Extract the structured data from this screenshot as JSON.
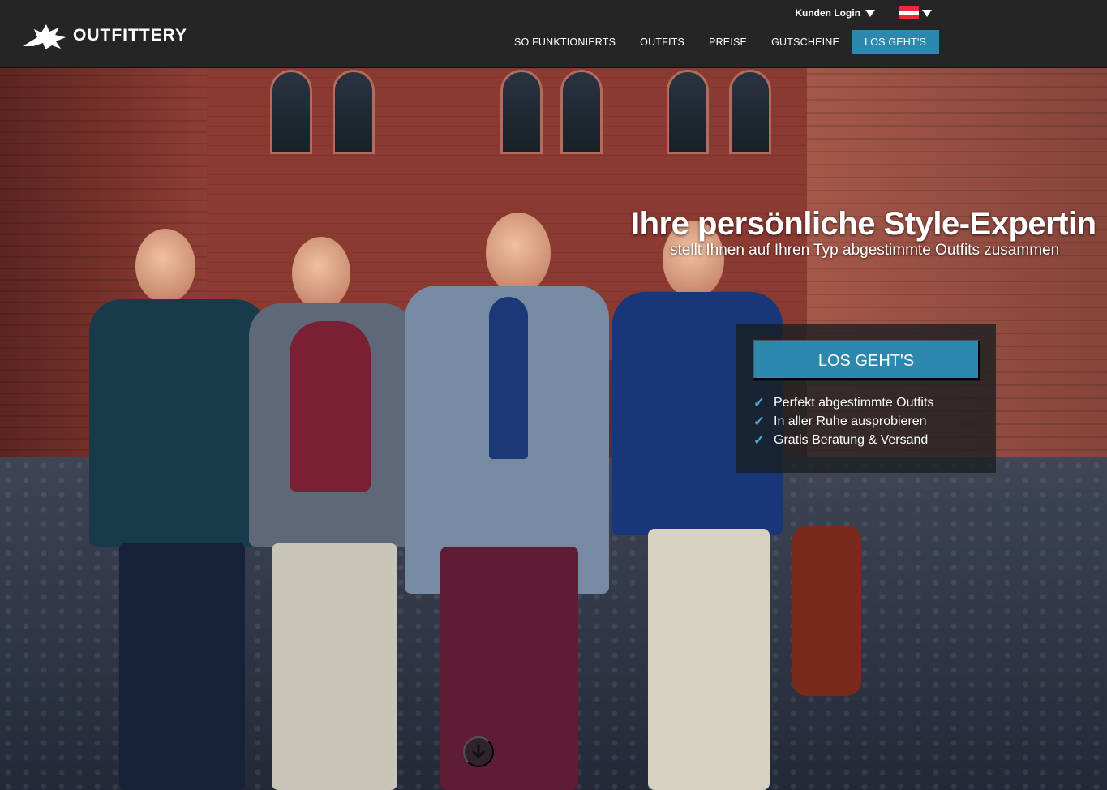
{
  "header": {
    "brand": "OUTFITTERY",
    "login_label": "Kunden Login",
    "language": "AT",
    "nav": [
      {
        "label": "SO FUNKTIONIERTS"
      },
      {
        "label": "OUTFITS"
      },
      {
        "label": "PREISE"
      },
      {
        "label": "GUTSCHEINE"
      },
      {
        "label": "LOS GEHT'S"
      }
    ]
  },
  "hero": {
    "title": "Ihre persönliche Style-Expertin",
    "subtitle": "stellt Ihnen auf Ihren Typ abgestimmte Outfits zusammen",
    "cta": "LOS GEHT'S",
    "features": [
      "Perfekt abgestimmte Outfits",
      "In aller Ruhe ausprobieren",
      "Gratis Beratung & Versand"
    ]
  },
  "colors": {
    "header_bg": "#252525",
    "accent": "#2d88b0",
    "check": "#4ba5d2"
  },
  "icons": {
    "logo": "outfittery-griffin-icon",
    "dropdown": "chevron-down-icon",
    "language": "austria-flag-icon",
    "feature": "check-icon",
    "scroll": "arrow-down-icon"
  }
}
